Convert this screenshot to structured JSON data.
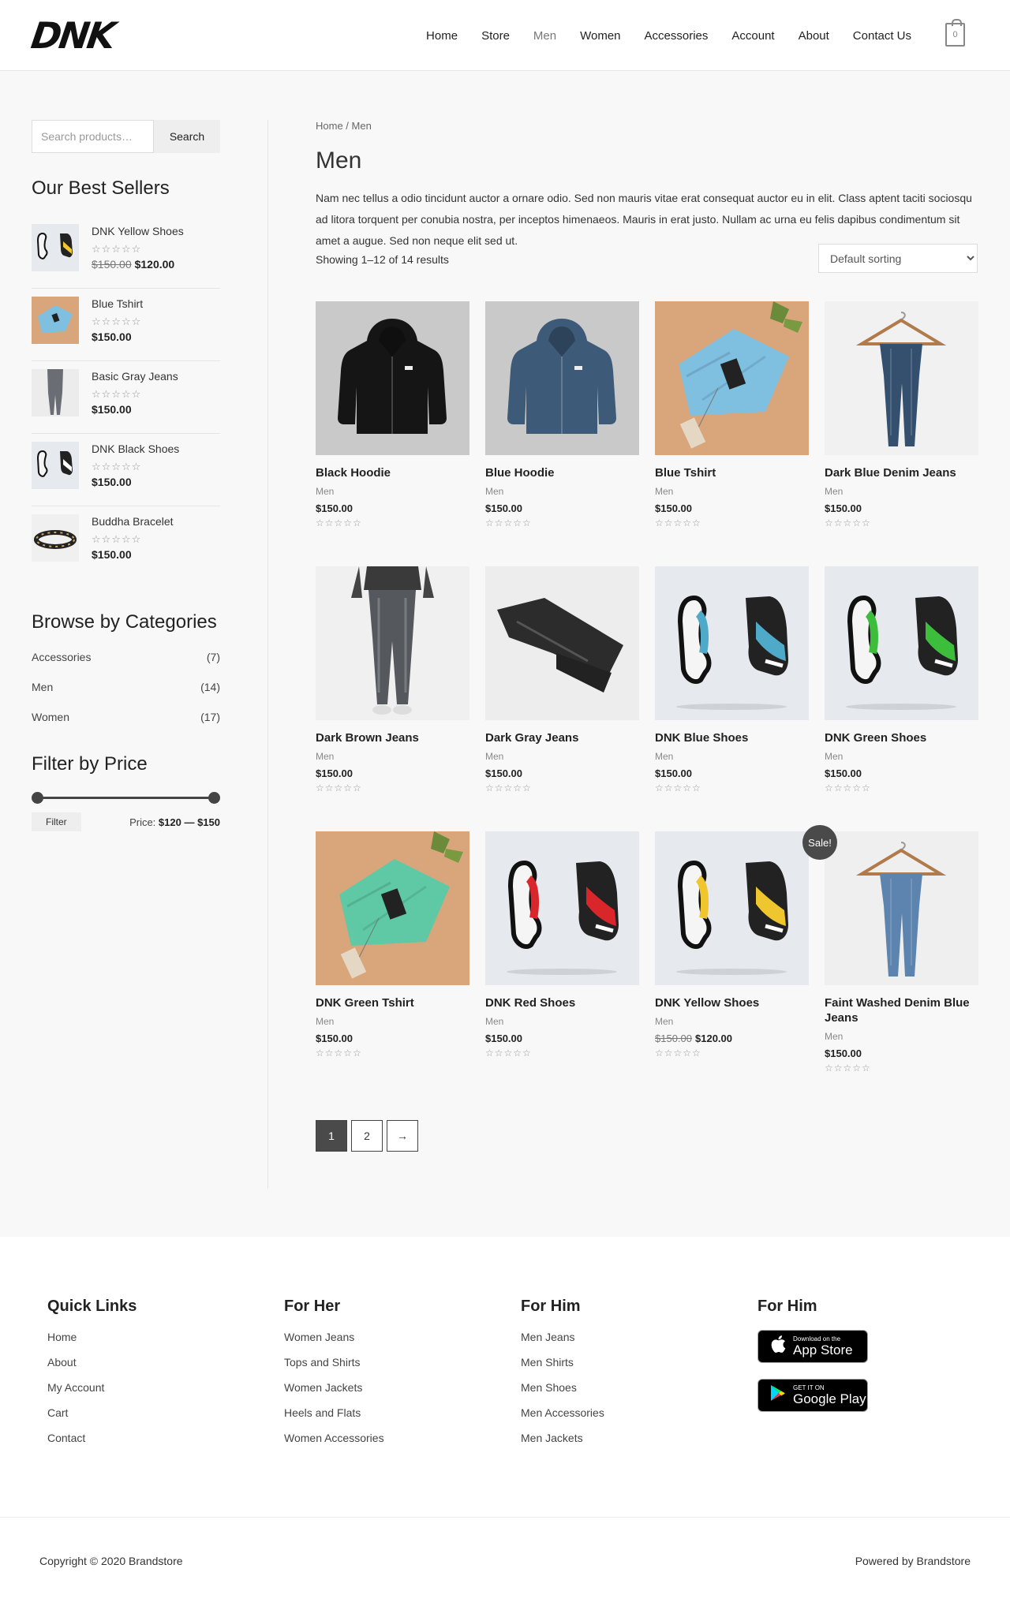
{
  "header": {
    "logo": "DNK",
    "nav": [
      "Home",
      "Store",
      "Men",
      "Women",
      "Accessories",
      "Account",
      "About",
      "Contact Us"
    ],
    "current_nav": "Men",
    "cart_count": "0"
  },
  "sidebar": {
    "search_placeholder": "Search products…",
    "search_button": "Search",
    "best_sellers_title": "Our Best Sellers",
    "best_sellers": [
      {
        "name": "DNK Yellow Shoes",
        "old_price": "$150.00",
        "price": "$120.00"
      },
      {
        "name": "Blue Tshirt",
        "old_price": "",
        "price": "$150.00"
      },
      {
        "name": "Basic Gray Jeans",
        "old_price": "",
        "price": "$150.00"
      },
      {
        "name": "DNK Black Shoes",
        "old_price": "",
        "price": "$150.00"
      },
      {
        "name": "Buddha Bracelet",
        "old_price": "",
        "price": "$150.00"
      }
    ],
    "categories_title": "Browse by Categories",
    "categories": [
      {
        "name": "Accessories",
        "count": "(7)"
      },
      {
        "name": "Men",
        "count": "(14)"
      },
      {
        "name": "Women",
        "count": "(17)"
      }
    ],
    "price_title": "Filter by Price",
    "filter_button": "Filter",
    "price_label": "Price:",
    "price_range": "$120 — $150",
    "price_min": 120,
    "price_max": 150
  },
  "main": {
    "breadcrumb": "Home / Men",
    "title": "Men",
    "description": "Nam nec tellus a odio tincidunt auctor a ornare odio. Sed non mauris vitae erat consequat auctor eu in elit. Class aptent taciti sociosqu ad litora torquent per conubia nostra, per inceptos himenaeos. Mauris in erat justo. Nullam ac urna eu felis dapibus condimentum sit amet a augue. Sed non neque elit sed ut.",
    "result_count": "Showing 1–12 of 14 results",
    "sort_options": [
      "Default sorting"
    ],
    "stars": "☆☆☆☆☆",
    "products": [
      {
        "name": "Black Hoodie",
        "category": "Men",
        "old_price": "",
        "price": "$150.00",
        "sale": false
      },
      {
        "name": "Blue Hoodie",
        "category": "Men",
        "old_price": "",
        "price": "$150.00",
        "sale": false
      },
      {
        "name": "Blue Tshirt",
        "category": "Men",
        "old_price": "",
        "price": "$150.00",
        "sale": false
      },
      {
        "name": "Dark Blue Denim Jeans",
        "category": "Men",
        "old_price": "",
        "price": "$150.00",
        "sale": false
      },
      {
        "name": "Dark Brown Jeans",
        "category": "Men",
        "old_price": "",
        "price": "$150.00",
        "sale": false
      },
      {
        "name": "Dark Gray Jeans",
        "category": "Men",
        "old_price": "",
        "price": "$150.00",
        "sale": false
      },
      {
        "name": "DNK Blue Shoes",
        "category": "Men",
        "old_price": "",
        "price": "$150.00",
        "sale": false
      },
      {
        "name": "DNK Green Shoes",
        "category": "Men",
        "old_price": "",
        "price": "$150.00",
        "sale": false
      },
      {
        "name": "DNK Green Tshirt",
        "category": "Men",
        "old_price": "",
        "price": "$150.00",
        "sale": false
      },
      {
        "name": "DNK Red Shoes",
        "category": "Men",
        "old_price": "",
        "price": "$150.00",
        "sale": false
      },
      {
        "name": "DNK Yellow Shoes",
        "category": "Men",
        "old_price": "$150.00",
        "price": "$120.00",
        "sale": true
      },
      {
        "name": "Faint Washed Denim Blue Jeans",
        "category": "Men",
        "old_price": "",
        "price": "$150.00",
        "sale": false
      }
    ],
    "sale_badge": "Sale!",
    "pagination": [
      "1",
      "2",
      "→"
    ]
  },
  "footer": {
    "columns": [
      {
        "title": "Quick Links",
        "links": [
          "Home",
          "About",
          "My Account",
          "Cart",
          "Contact"
        ]
      },
      {
        "title": "For Her",
        "links": [
          "Women Jeans",
          "Tops and Shirts",
          "Women Jackets",
          "Heels and Flats",
          "Women Accessories"
        ]
      },
      {
        "title": "For Him",
        "links": [
          "Men Jeans",
          "Men Shirts",
          "Men Shoes",
          "Men Accessories",
          "Men Jackets"
        ]
      }
    ],
    "apps_title": "For Him",
    "app_store_small": "Download on the",
    "app_store_big": "App Store",
    "google_play_small": "GET IT ON",
    "google_play_big": "Google Play",
    "copyright": "Copyright © 2020 Brandstore",
    "powered": "Powered by Brandstore"
  }
}
